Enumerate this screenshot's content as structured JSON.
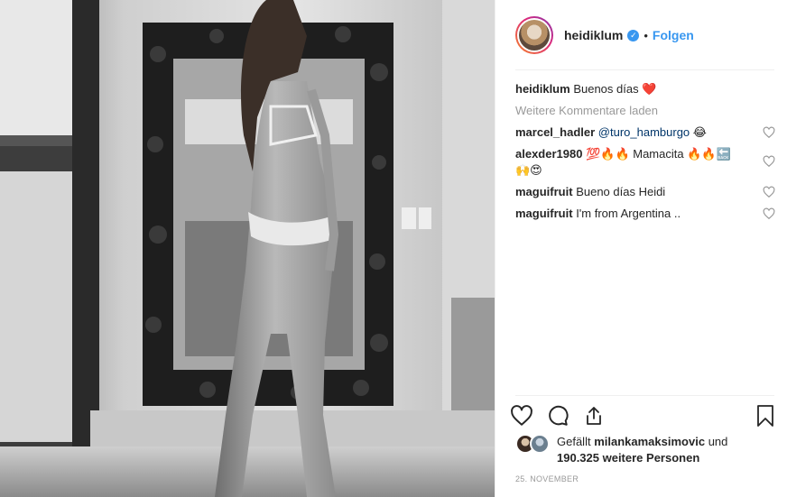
{
  "post": {
    "username": "heidiklum",
    "separator": "•",
    "follow_label": "Folgen",
    "verified_glyph": "✓"
  },
  "caption": {
    "user": "heidiklum",
    "text": "Buenos días",
    "emoji": "❤️"
  },
  "load_more": "Weitere Kommentare laden",
  "comments": [
    {
      "user": "marcel_hadler",
      "mention": "@turo_hamburgo",
      "text": "😂"
    },
    {
      "user": "alexder1980",
      "text": "💯🔥🔥 Mamacita 🔥🔥🔙",
      "text2": "🙌😍"
    },
    {
      "user": "maguifruit",
      "text": "Bueno días Heidi"
    },
    {
      "user": "maguifruit",
      "text": "I'm from Argentina .."
    }
  ],
  "likes": {
    "prefix": "Gefällt",
    "user": "milankamaksimovic",
    "and": "und",
    "count": "190.325 weitere Personen"
  },
  "date": "25. NOVEMBER",
  "icons": {
    "like": "heart-outline-icon",
    "comment": "speech-bubble-icon",
    "share": "share-arrow-icon",
    "save": "bookmark-icon"
  },
  "colors": {
    "accent": "#3897f0",
    "muted": "#999999",
    "text": "#262626"
  }
}
